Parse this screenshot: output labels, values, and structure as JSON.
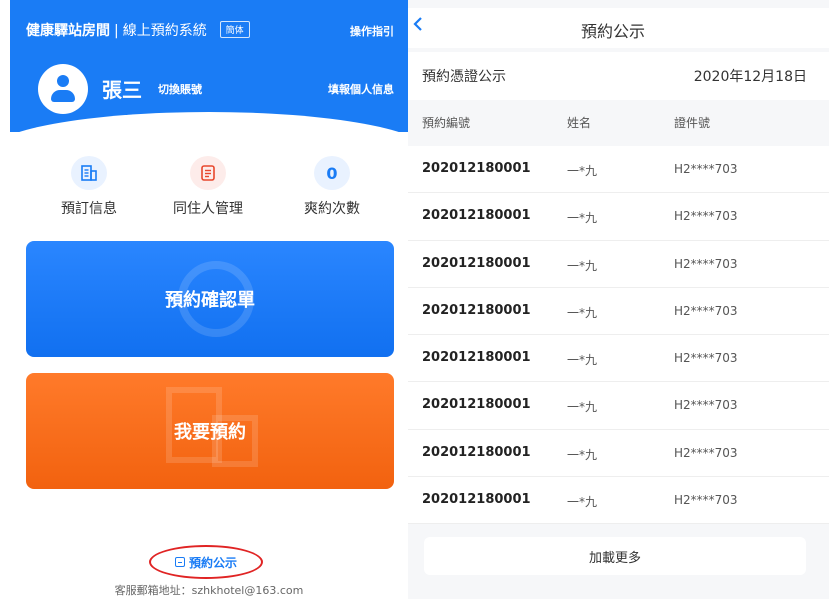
{
  "left": {
    "brand": "健康驛站房間",
    "system": "線上預約系統",
    "lang_badge": "簡体",
    "guide": "操作指引",
    "username": "張三",
    "switch_account": "切換賬號",
    "fill_info": "填報個人信息",
    "shortcuts": [
      {
        "label": "預訂信息",
        "icon": "building-icon"
      },
      {
        "label": "同住人管理",
        "icon": "list-icon"
      },
      {
        "label": "爽約次數",
        "count": "0"
      }
    ],
    "card_confirm": "預約確認單",
    "card_book": "我要預約",
    "notice_link": "預約公示",
    "service_email": "客服郵箱地址：szhkhotel@163.com"
  },
  "right": {
    "back_icon": "chevron-left-icon",
    "title": "預約公示",
    "subtitle": "預約憑證公示",
    "date": "2020年12月18日",
    "columns": [
      "預約編號",
      "姓名",
      "證件號"
    ],
    "rows": [
      [
        "202012180001",
        "一*九",
        "H2****703"
      ],
      [
        "202012180001",
        "一*九",
        "H2****703"
      ],
      [
        "202012180001",
        "一*九",
        "H2****703"
      ],
      [
        "202012180001",
        "一*九",
        "H2****703"
      ],
      [
        "202012180001",
        "一*九",
        "H2****703"
      ],
      [
        "202012180001",
        "一*九",
        "H2****703"
      ],
      [
        "202012180001",
        "一*九",
        "H2****703"
      ],
      [
        "202012180001",
        "一*九",
        "H2****703"
      ]
    ],
    "load_more": "加載更多"
  },
  "colors": {
    "primary_blue": "#1a7cf5",
    "orange": "#f2620f",
    "highlight_red": "#e02424"
  }
}
